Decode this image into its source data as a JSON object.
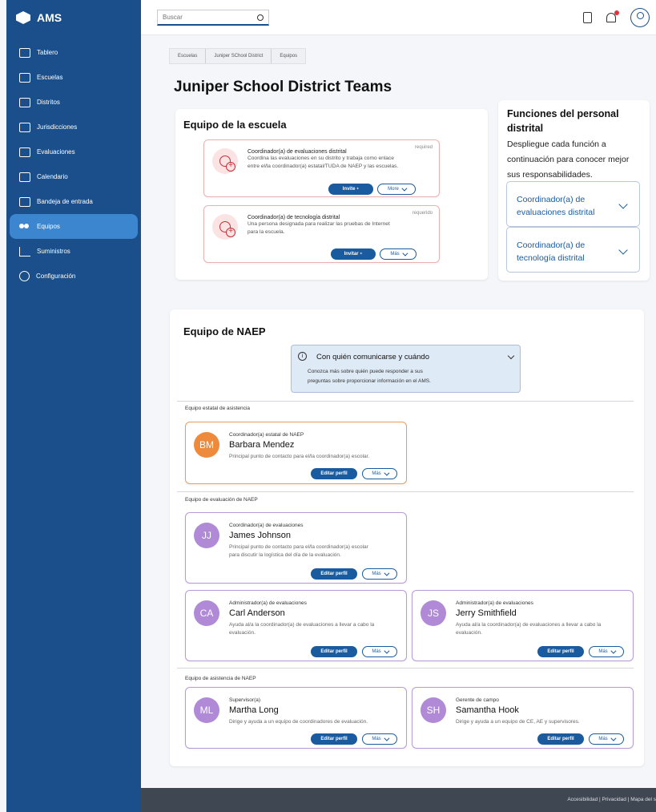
{
  "app": {
    "title": "AMS"
  },
  "sidebar": {
    "items": [
      {
        "label": "Tablero",
        "icon": "dashboard-icon"
      },
      {
        "label": "Escuelas",
        "icon": "school-icon"
      },
      {
        "label": "Distritos",
        "icon": "district-icon"
      },
      {
        "label": "Jurisdicciones",
        "icon": "jurisdiction-icon"
      },
      {
        "label": "Evaluaciones",
        "icon": "laptop-icon"
      },
      {
        "label": "Calendario",
        "icon": "calendar-icon"
      },
      {
        "label": "Bandeja de entrada",
        "icon": "inbox-icon"
      },
      {
        "label": "Equipos",
        "icon": "people-icon",
        "active": true
      },
      {
        "label": "Suministros",
        "icon": "cart-icon"
      },
      {
        "label": "Configuración",
        "icon": "gear-icon"
      }
    ]
  },
  "topbar": {
    "search_placeholder": "Buscar"
  },
  "breadcrumb": [
    "Escuelas",
    "Juniper SChool District",
    "Equipos"
  ],
  "page_title": "Juniper School District Teams",
  "school_team": {
    "title": "Equipo de la escuela",
    "roles": [
      {
        "required": "required",
        "title": "Coordinador(a) de evaluaciones distrital",
        "desc1": "Coordina las evaluaciones en su distrito y trabaja como enlace",
        "desc2": "entre el/la coordinador(a) estatal/TUDA de NAEP y las escuelas.",
        "invite": "Invite",
        "more": "More"
      },
      {
        "required": "requerido",
        "title": "Coordinador(a) de tecnología distrital",
        "desc1": "Una persona designada para realizar las pruebas de Internet",
        "desc2": "para la escuela.",
        "invite": "Invitar",
        "more": "Más"
      }
    ]
  },
  "functions": {
    "title1": "Funciones del personal",
    "title2": "distrital",
    "desc1": "Despliegue cada función a",
    "desc2": "continuación para conocer mejor",
    "desc3": "sus responsabilidades.",
    "items": [
      {
        "line1": "Coordinador(a) de",
        "line2": "evaluaciones distrital"
      },
      {
        "line1": "Coordinador(a) de",
        "line2": "tecnología distrital"
      }
    ]
  },
  "naep": {
    "title": "Equipo de NAEP",
    "info": {
      "title": "Con quién comunicarse y cuándo",
      "line1": "Conozca más sobre quién puede responder a sus",
      "line2": "preguntas sobre proporcionar información en el AMS."
    },
    "groups": {
      "state": "Equipo estatal de asistencia",
      "eval": "Equipo de evaluación de NAEP",
      "assist": "Equipo de asistencia de NAEP"
    },
    "people": [
      {
        "initials": "BM",
        "role": "Coordinador(a) estatal de NAEP",
        "name": "Barbara Mendez",
        "desc1": "Principal punto de contacto para el/la coordinador(a) escolar.",
        "desc2": "",
        "color": "#ee8a3c",
        "border": "#ee9b5a"
      },
      {
        "initials": "JJ",
        "role": "Coordinador(a) de evaluaciones",
        "name": "James Johnson",
        "desc1": "Principal punto de contacto para el/la coordinador(a) escolar",
        "desc2": "para discutir la logística del día de la evaluación.",
        "color": "#b08ad6",
        "border": "#b79ad9"
      },
      {
        "initials": "CA",
        "role": "Administrador(a) de evaluaciones",
        "name": "Carl Anderson",
        "desc1": "Ayuda al/a la coordinador(a) de evaluaciones a llevar a cabo la",
        "desc2": "evaluación.",
        "color": "#b08ad6",
        "border": "#b79ad9"
      },
      {
        "initials": "JS",
        "role": "Administrador(a) de evaluaciones",
        "name": "Jerry Smithfield",
        "desc1": "Ayuda al/a la coordinador(a) de evaluaciones a llevar a cabo la",
        "desc2": "evaluación.",
        "color": "#b08ad6",
        "border": "#b79ad9"
      },
      {
        "initials": "ML",
        "role": "Supervisor(a)",
        "name": "Martha Long",
        "desc1": "Dirige y ayuda a un equipo de coordinadores de evaluación.",
        "desc2": "",
        "color": "#b08ad6",
        "border": "#b79ad9"
      },
      {
        "initials": "SH",
        "role": "Gerente de campo",
        "name": "Samantha Hook",
        "desc1": "Dirige y ayuda a un equipo de CE, AE y supervisores.",
        "desc2": "",
        "color": "#b08ad6",
        "border": "#b79ad9"
      }
    ],
    "edit_label": "Editar perfil",
    "more_label": "Más"
  },
  "footer": {
    "links": "Accesibilidad  |  Privacidad  |  Mapa del s"
  },
  "colors": {
    "sidebar": "#1a4f8b",
    "active": "#3c86cf",
    "primary": "#1a5a9e"
  }
}
